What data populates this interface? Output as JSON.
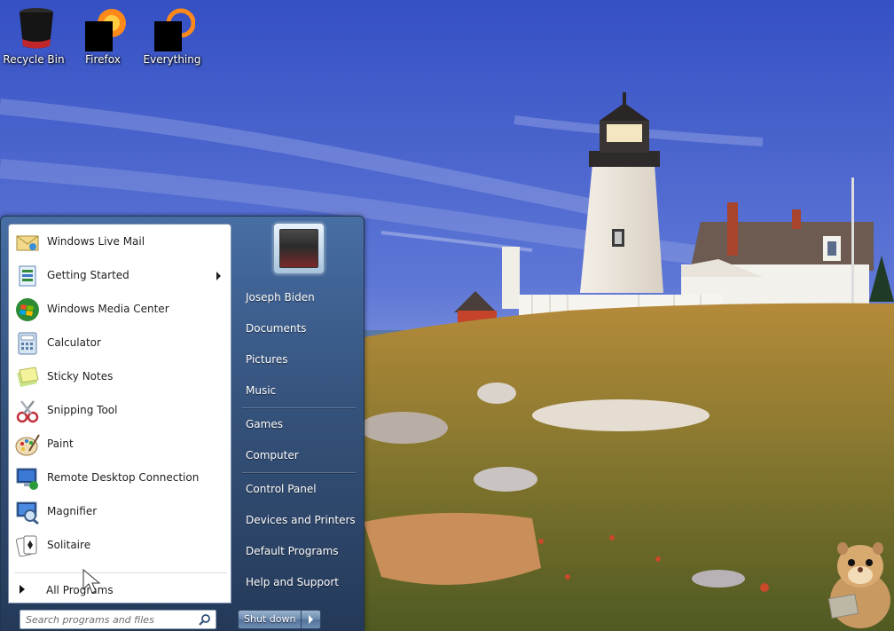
{
  "desktop": {
    "icons": [
      {
        "label": "Recycle Bin",
        "icon": "recycle-bin-icon"
      },
      {
        "label": "Firefox",
        "icon": "firefox-icon"
      },
      {
        "label": "Everything",
        "icon": "everything-search-icon"
      }
    ],
    "wallpaper": "lighthouse-landscape"
  },
  "start_menu": {
    "programs": [
      {
        "label": "Windows Live Mail",
        "icon": "mail-icon"
      },
      {
        "label": "Getting Started",
        "icon": "getting-started-icon",
        "has_submenu": true
      },
      {
        "label": "Windows Media Center",
        "icon": "media-center-icon"
      },
      {
        "label": "Calculator",
        "icon": "calculator-icon"
      },
      {
        "label": "Sticky Notes",
        "icon": "sticky-notes-icon"
      },
      {
        "label": "Snipping Tool",
        "icon": "scissors-icon"
      },
      {
        "label": "Paint",
        "icon": "paint-palette-icon"
      },
      {
        "label": "Remote Desktop Connection",
        "icon": "remote-desktop-icon"
      },
      {
        "label": "Magnifier",
        "icon": "magnifier-icon"
      },
      {
        "label": "Solitaire",
        "icon": "solitaire-cards-icon"
      }
    ],
    "all_programs_label": "All Programs",
    "search_placeholder": "Search programs and files",
    "right_links": [
      {
        "label": "Joseph Biden"
      },
      {
        "label": "Documents"
      },
      {
        "label": "Pictures"
      },
      {
        "label": "Music"
      },
      {
        "label": "Games"
      },
      {
        "label": "Computer"
      },
      {
        "label": "Control Panel"
      },
      {
        "label": "Devices and Printers"
      },
      {
        "label": "Default Programs"
      },
      {
        "label": "Help and Support"
      }
    ],
    "shutdown_label": "Shut down"
  },
  "colors": {
    "sky_top": "#3a56c8",
    "sky_bottom": "#8ea3e0",
    "grass": "#7a6a2a",
    "menu_right_pane": "#3c5f8a"
  }
}
